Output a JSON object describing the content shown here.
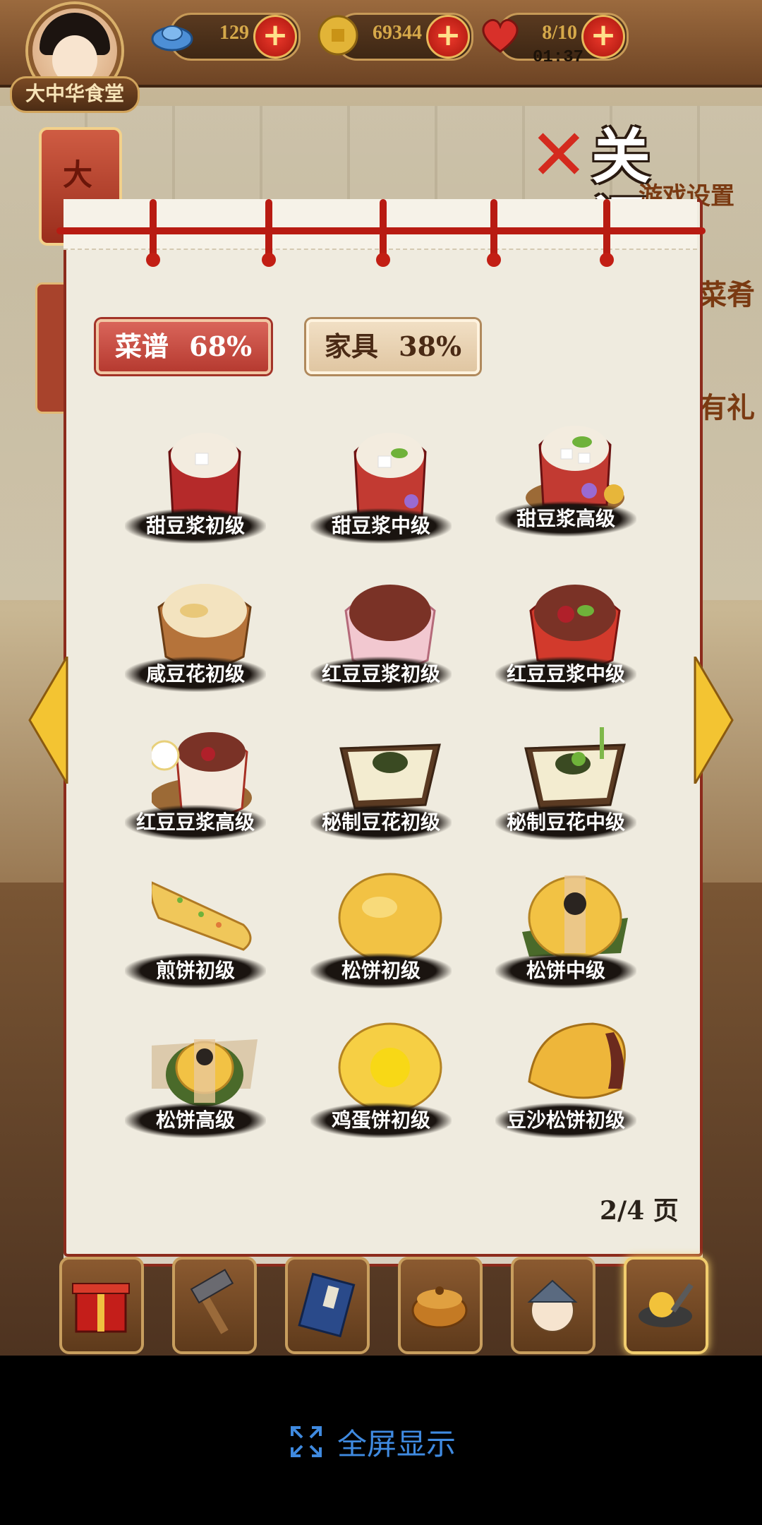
{
  "resources": [
    {
      "name": "ingots",
      "value": "129",
      "icon": "silver-ingot-icon"
    },
    {
      "name": "coins",
      "value": "69344",
      "icon": "gold-coin-icon"
    },
    {
      "name": "stamina",
      "value": "8/10",
      "icon": "heart-icon"
    }
  ],
  "timer": "01:37",
  "shop": {
    "name": "大中华食堂"
  },
  "side_tab": {
    "label": "大观"
  },
  "close": {
    "label": "关闭",
    "subtitle": "游戏设置"
  },
  "side_right": {
    "label_1": "菜肴",
    "label_2": "有礼"
  },
  "tabs": [
    {
      "label": "菜谱",
      "percent": "68%"
    },
    {
      "label": "家具",
      "percent": "38%"
    }
  ],
  "items": [
    {
      "label": "甜豆浆初级",
      "icon": "sweet-soymilk-basic-icon"
    },
    {
      "label": "甜豆浆中级",
      "icon": "sweet-soymilk-mid-icon"
    },
    {
      "label": "甜豆浆高级",
      "icon": "sweet-soymilk-high-icon"
    },
    {
      "label": "咸豆花初级",
      "icon": "salty-tofu-pudding-icon"
    },
    {
      "label": "红豆豆浆初级",
      "icon": "redbean-soymilk-basic-icon"
    },
    {
      "label": "红豆豆浆中级",
      "icon": "redbean-soymilk-mid-icon"
    },
    {
      "label": "红豆豆浆高级",
      "icon": "redbean-soymilk-high-icon"
    },
    {
      "label": "秘制豆花初级",
      "icon": "secret-tofu-basic-icon"
    },
    {
      "label": "秘制豆花中级",
      "icon": "secret-tofu-mid-icon"
    },
    {
      "label": "煎饼初级",
      "icon": "jianbing-basic-icon"
    },
    {
      "label": "松饼初级",
      "icon": "pancake-basic-icon"
    },
    {
      "label": "松饼中级",
      "icon": "pancake-mid-icon"
    },
    {
      "label": "松饼高级",
      "icon": "pancake-high-icon"
    },
    {
      "label": "鸡蛋饼初级",
      "icon": "egg-pancake-basic-icon"
    },
    {
      "label": "豆沙松饼初级",
      "icon": "redbean-pancake-basic-icon"
    }
  ],
  "page_indicator": "2/4 页",
  "toolbar": [
    {
      "name": "gift-box",
      "icon": "gift-box-icon"
    },
    {
      "name": "hammer",
      "icon": "hammer-icon"
    },
    {
      "name": "book",
      "icon": "book-icon"
    },
    {
      "name": "pot",
      "icon": "pot-icon"
    },
    {
      "name": "chef",
      "icon": "chef-icon"
    },
    {
      "name": "wok",
      "icon": "wok-icon"
    }
  ],
  "fullscreen": {
    "label": "全屏显示",
    "icon": "expand-icon"
  },
  "colors": {
    "accent_red": "#b81b12",
    "tab_red": "#c24a3e",
    "fullscreen_blue": "#3f8ae0"
  }
}
